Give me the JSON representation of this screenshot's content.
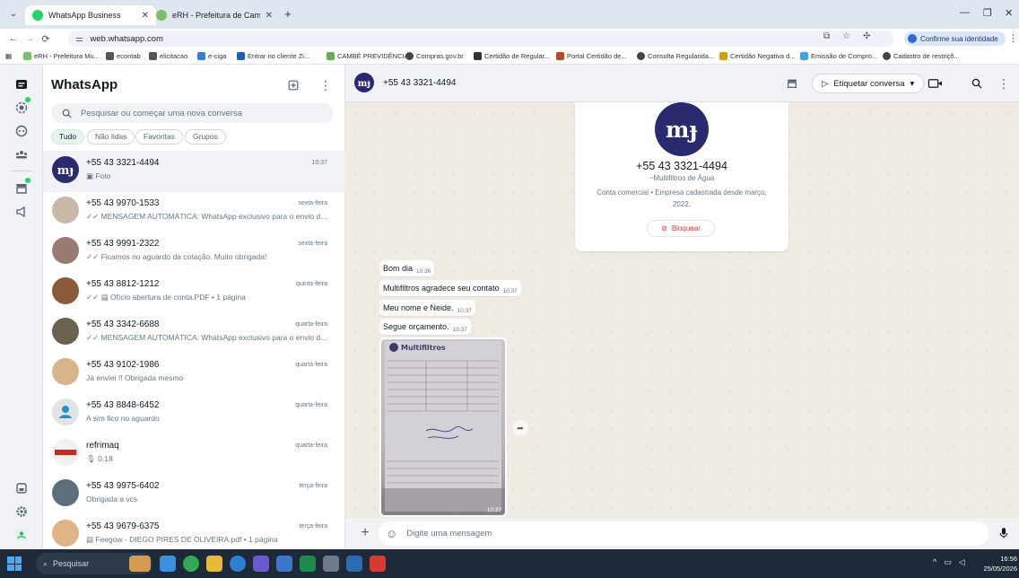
{
  "browser": {
    "tabs": [
      {
        "title": "WhatsApp Business",
        "active": true
      },
      {
        "title": "eRH - Prefeitura de Cambé",
        "active": false
      }
    ],
    "url": "web.whatsapp.com",
    "identity_label": "Confirme sua identidade",
    "bookmarks": [
      "eRH - Prefeitura Mu...",
      "econtab",
      "elicitacao",
      "e-ciga",
      "Entrar no cliente Zi...",
      "CAMBÉ PREVIDÊNCIA",
      "Compras.gov.br",
      "Certidão de Regular...",
      "Portal Certidão de...",
      "Consulta Regularida...",
      "Certidão Negativa d...",
      "Emissão de Compro...",
      "Cadastro de restriçõ..."
    ]
  },
  "sidebar": {
    "title": "WhatsApp",
    "search_placeholder": "Pesquisar ou começar uma nova conversa",
    "filters": [
      "Tudo",
      "Não lidas",
      "Favoritas",
      "Grupos"
    ],
    "chats": [
      {
        "name": "+55 43 3321-4494",
        "time": "10:37",
        "snippet": "▣ Foto",
        "active": true
      },
      {
        "name": "+55 43 9970-1533",
        "time": "sexta-feira",
        "snippet": "✓✓ MENSAGEM AUTOMÁTICA:  WhatsApp exclusivo para o envio de re..."
      },
      {
        "name": "+55 43 9991-2322",
        "time": "sexta-feira",
        "snippet": "✓✓ Ficamos no aguardo da cotação. Muito obrigada!"
      },
      {
        "name": "+55 43 8812-1212",
        "time": "quinta-feira",
        "snippet": "✓✓ ▤ Ofício abertura de conta.PDF • 1 página"
      },
      {
        "name": "+55 43 3342-6688",
        "time": "quarta-feira",
        "snippet": "✓✓ MENSAGEM AUTOMÁTICA:  WhatsApp exclusivo para o envio de re..."
      },
      {
        "name": "+55 43 9102-1986",
        "time": "quarta-feira",
        "snippet": "Já enviei !! Obrigada mesmo"
      },
      {
        "name": "+55 43 8848-6452",
        "time": "quarta-feira",
        "snippet": "A sim fico no aguardo"
      },
      {
        "name": "refrimaq",
        "time": "quarta-feira",
        "snippet": "🎙 0:18"
      },
      {
        "name": "+55 43 9975-6402",
        "time": "terça-feira",
        "snippet": "Obrigada a vcs"
      },
      {
        "name": "+55 43 9679-6375",
        "time": "terça-feira",
        "snippet": "▤ Feegow - DIEGO PIRES DE OLIVEIRA.pdf • 1 página"
      }
    ]
  },
  "conversation": {
    "contact": "+55 43 3321-4494",
    "label_button": "Etiquetar conversa",
    "business": {
      "number": "+55 43 3321-4494",
      "subtitle": "~Multifiltros de Água",
      "description": "Conta comercial • Empresa cadastrada desde março, 2022.",
      "block_label": "Bloquear"
    },
    "messages": [
      {
        "text": "Bom dia",
        "time": "10:36"
      },
      {
        "text": "Multifiltros agradece seu contato",
        "time": "10:37"
      },
      {
        "text": "Meu nome e Neide.",
        "time": "10:37"
      },
      {
        "text": "Segue orçamento.",
        "time": "10:37"
      }
    ],
    "image_message": {
      "time": "10:37",
      "doc_header": "Multifiltros"
    },
    "input_placeholder": "Digite uma mensagem"
  },
  "taskbar": {
    "search_placeholder": "Pesquisar",
    "clock_time": "16:56",
    "clock_date": "25/05/2026"
  },
  "colors": {
    "accent": "#25d366",
    "brand_logo": "#2a2a6e",
    "danger": "#d22f3a"
  }
}
